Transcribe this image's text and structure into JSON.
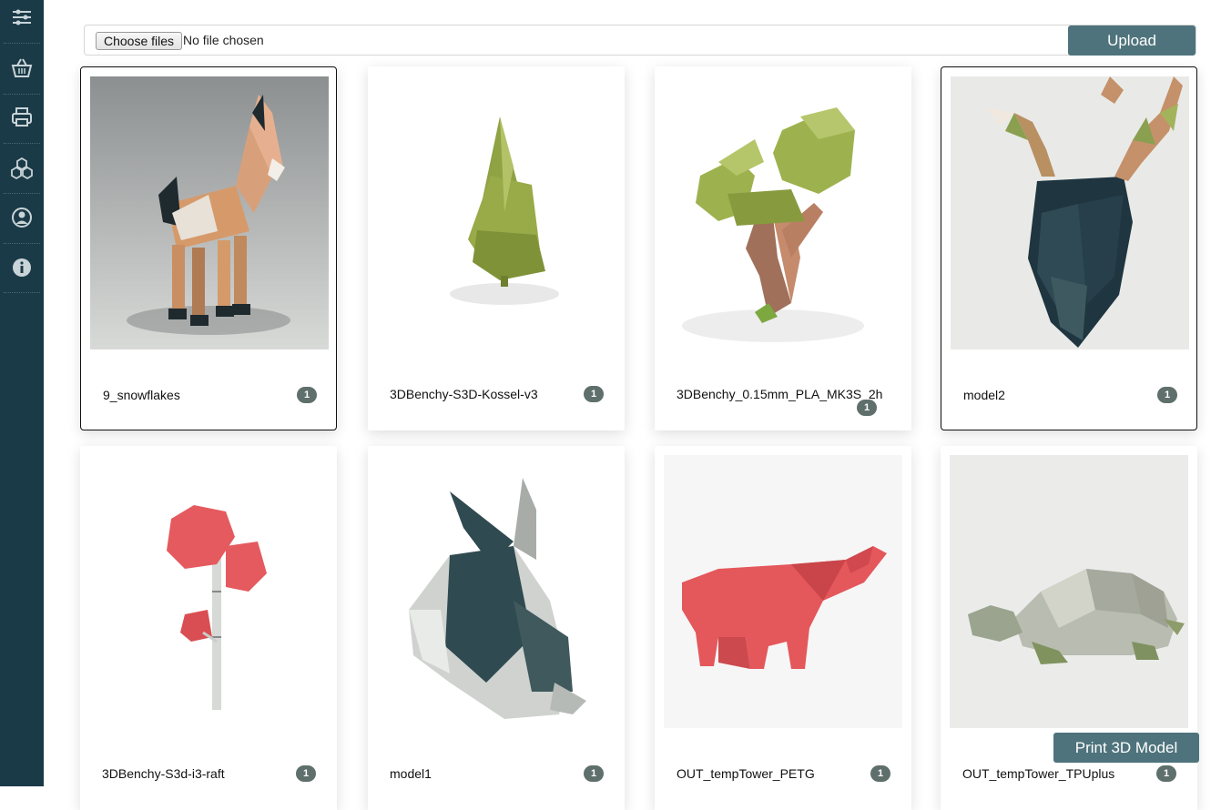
{
  "sidebar": {
    "items": [
      {
        "icon": "sliders-icon"
      },
      {
        "icon": "basket-icon"
      },
      {
        "icon": "printer-icon"
      },
      {
        "icon": "cubes-icon"
      },
      {
        "icon": "user-icon"
      },
      {
        "icon": "info-icon"
      }
    ],
    "background": "#1b3a47"
  },
  "upload": {
    "choose_label": "Choose files",
    "file_status": "No file chosen",
    "upload_label": "Upload"
  },
  "models": [
    {
      "name": "9_snowflakes",
      "count": "1",
      "selected": true
    },
    {
      "name": "3DBenchy-S3D-Kossel-v3",
      "count": "1",
      "selected": false
    },
    {
      "name": "3DBenchy_0.15mm_PLA_MK3S_2h",
      "count": "1",
      "selected": false
    },
    {
      "name": "model2",
      "count": "1",
      "selected": true
    },
    {
      "name": "3DBenchy-S3d-i3-raft",
      "count": "1",
      "selected": false
    },
    {
      "name": "model1",
      "count": "1",
      "selected": false
    },
    {
      "name": "OUT_tempTower_PETG",
      "count": "1",
      "selected": false
    },
    {
      "name": "OUT_tempTower_TPUplus",
      "count": "1",
      "selected": false
    }
  ],
  "actions": {
    "print_label": "Print 3D Model"
  },
  "colors": {
    "accent": "#4e737c",
    "badge": "#5f6f6b"
  }
}
